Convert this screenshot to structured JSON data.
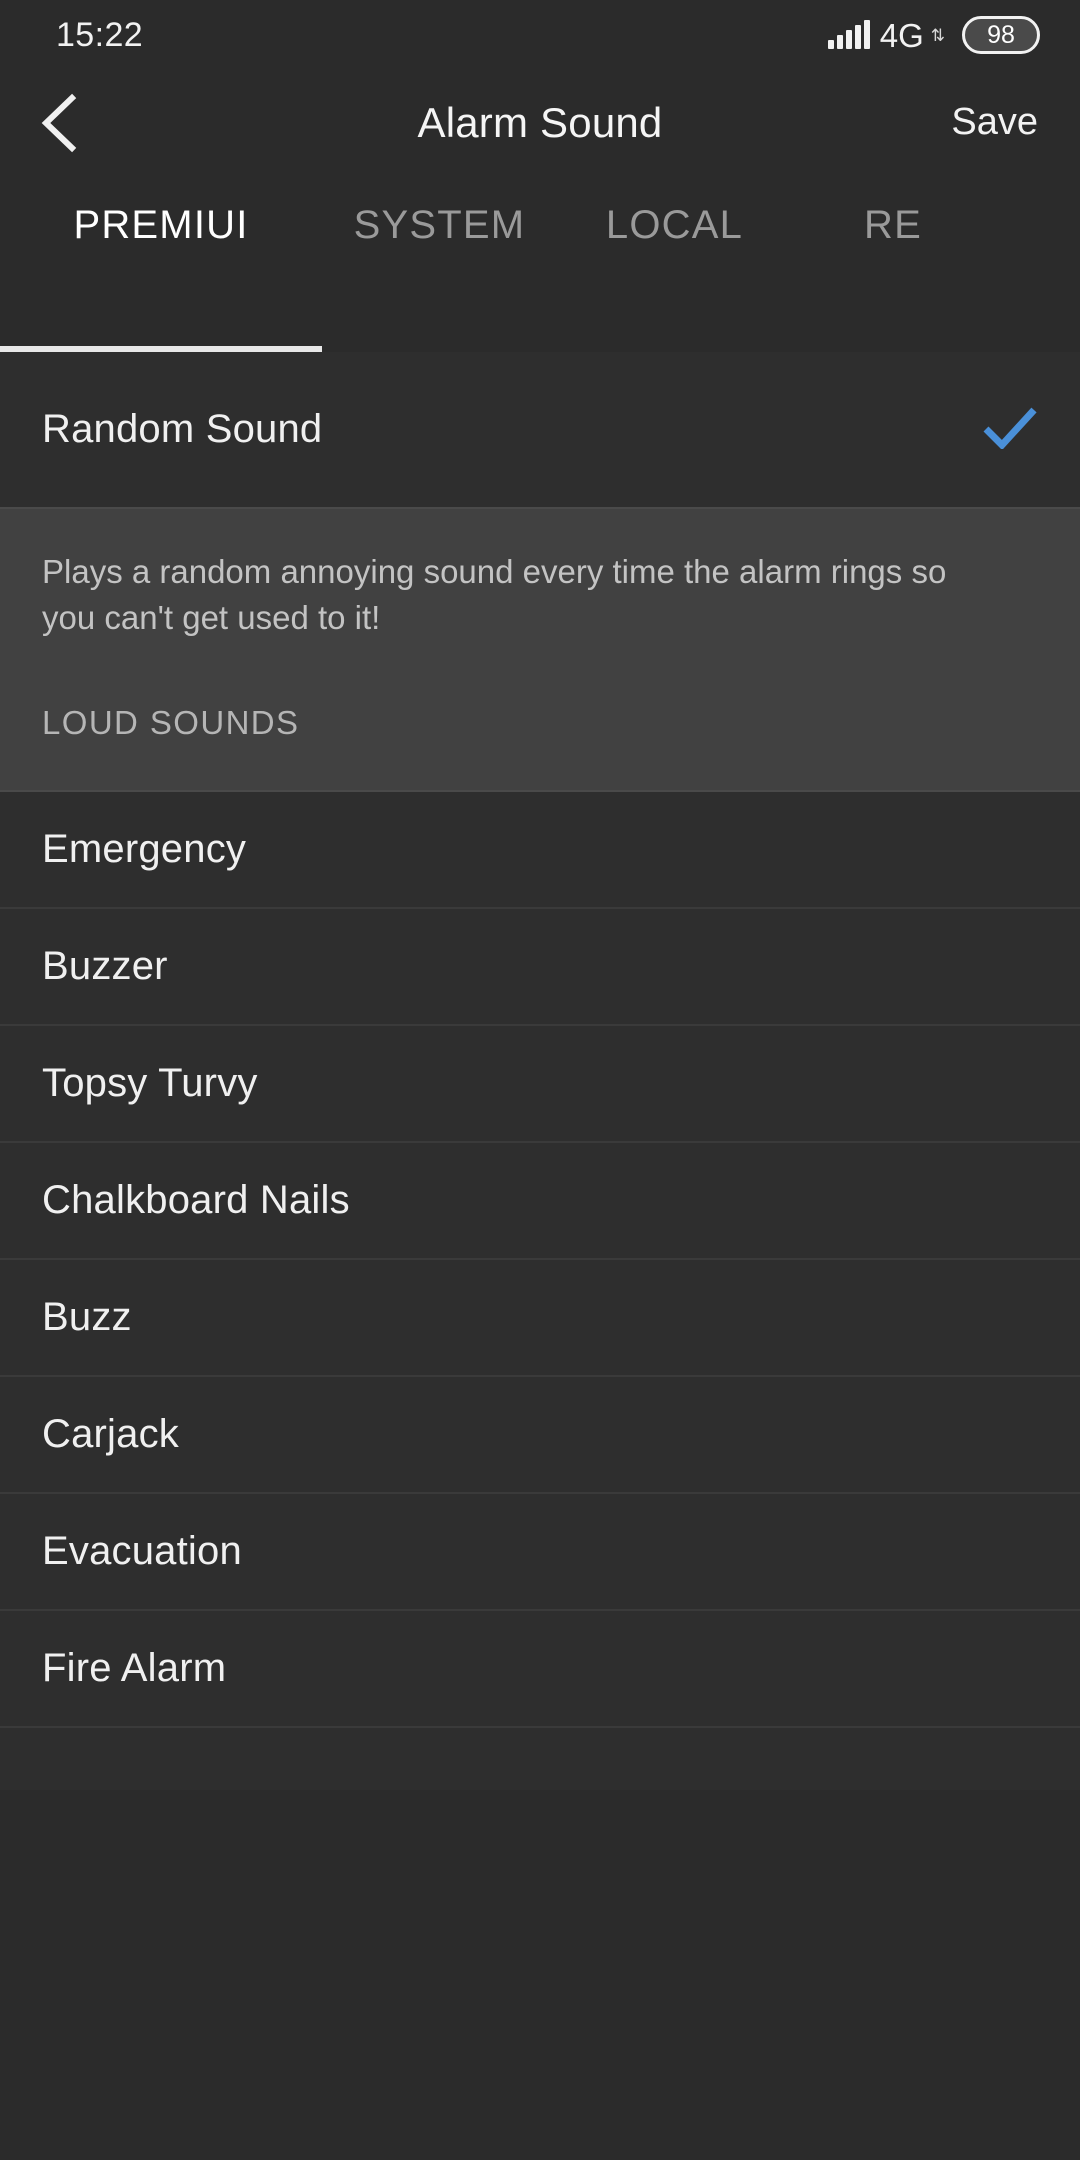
{
  "status_bar": {
    "time": "15:22",
    "signal_icon": "signal-bars-icon",
    "network_type": "4G",
    "data_arrows": "⇅",
    "battery_percent": "98"
  },
  "toolbar": {
    "back_icon": "back-chevron-icon",
    "title": "Alarm Sound",
    "save_label": "Save"
  },
  "tabs": {
    "items": [
      {
        "label": "PREMIUI",
        "active": true
      },
      {
        "label": "SYSTEM",
        "active": false
      },
      {
        "label": "LOCAL",
        "active": false
      },
      {
        "label": "RE",
        "active": false
      }
    ],
    "indicator_color": "#e8e8e8"
  },
  "random_sound": {
    "label": "Random Sound",
    "selected": true,
    "check_icon": "check-icon",
    "check_color": "#4a90d9",
    "description": "Plays a random annoying sound every time the alarm rings so you can't get used to it!"
  },
  "section": {
    "header": "LOUD SOUNDS"
  },
  "sounds": [
    {
      "label": "Emergency"
    },
    {
      "label": "Buzzer"
    },
    {
      "label": "Topsy Turvy"
    },
    {
      "label": "Chalkboard Nails"
    },
    {
      "label": "Buzz"
    },
    {
      "label": "Carjack"
    },
    {
      "label": "Evacuation"
    },
    {
      "label": "Fire Alarm"
    }
  ]
}
